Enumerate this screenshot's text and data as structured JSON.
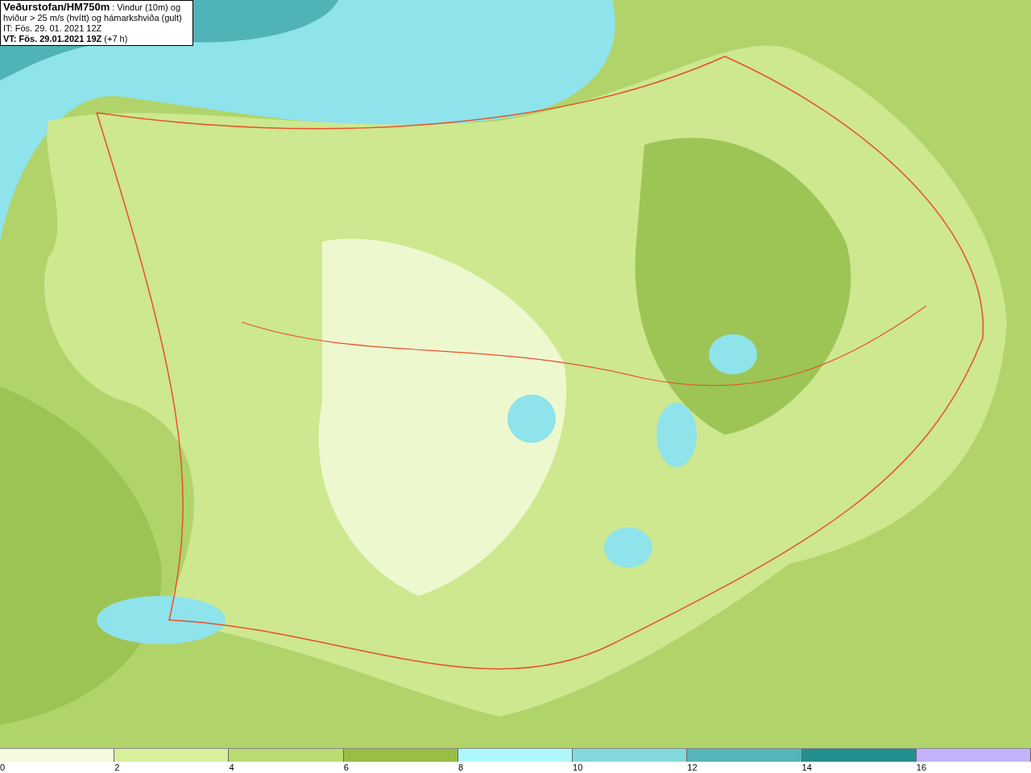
{
  "info_box": {
    "title": "**Veðurstofan/HM750m** : Vindur (10m) og hviður > 25 m/s (hvítt) og hámarkshviða (gult)",
    "issued": "IT: Fös. 29. 01. 2021 12Z",
    "valid": "**VT: Fös. 29.01.2021 19Z** (+7 h)"
  },
  "legend": [
    {
      "label": "0",
      "color": "#f4fbdf"
    },
    {
      "label": "2",
      "color": "#d8f09c"
    },
    {
      "label": "4",
      "color": "#b9db72"
    },
    {
      "label": "6",
      "color": "#98be44"
    },
    {
      "label": "8",
      "color": "#aef8fb"
    },
    {
      "label": "10",
      "color": "#84d9dc"
    },
    {
      "label": "12",
      "color": "#55b5b8"
    },
    {
      "label": "14",
      "color": "#238f8f"
    },
    {
      "label": "16",
      "color": "#c3b3fa"
    }
  ]
}
